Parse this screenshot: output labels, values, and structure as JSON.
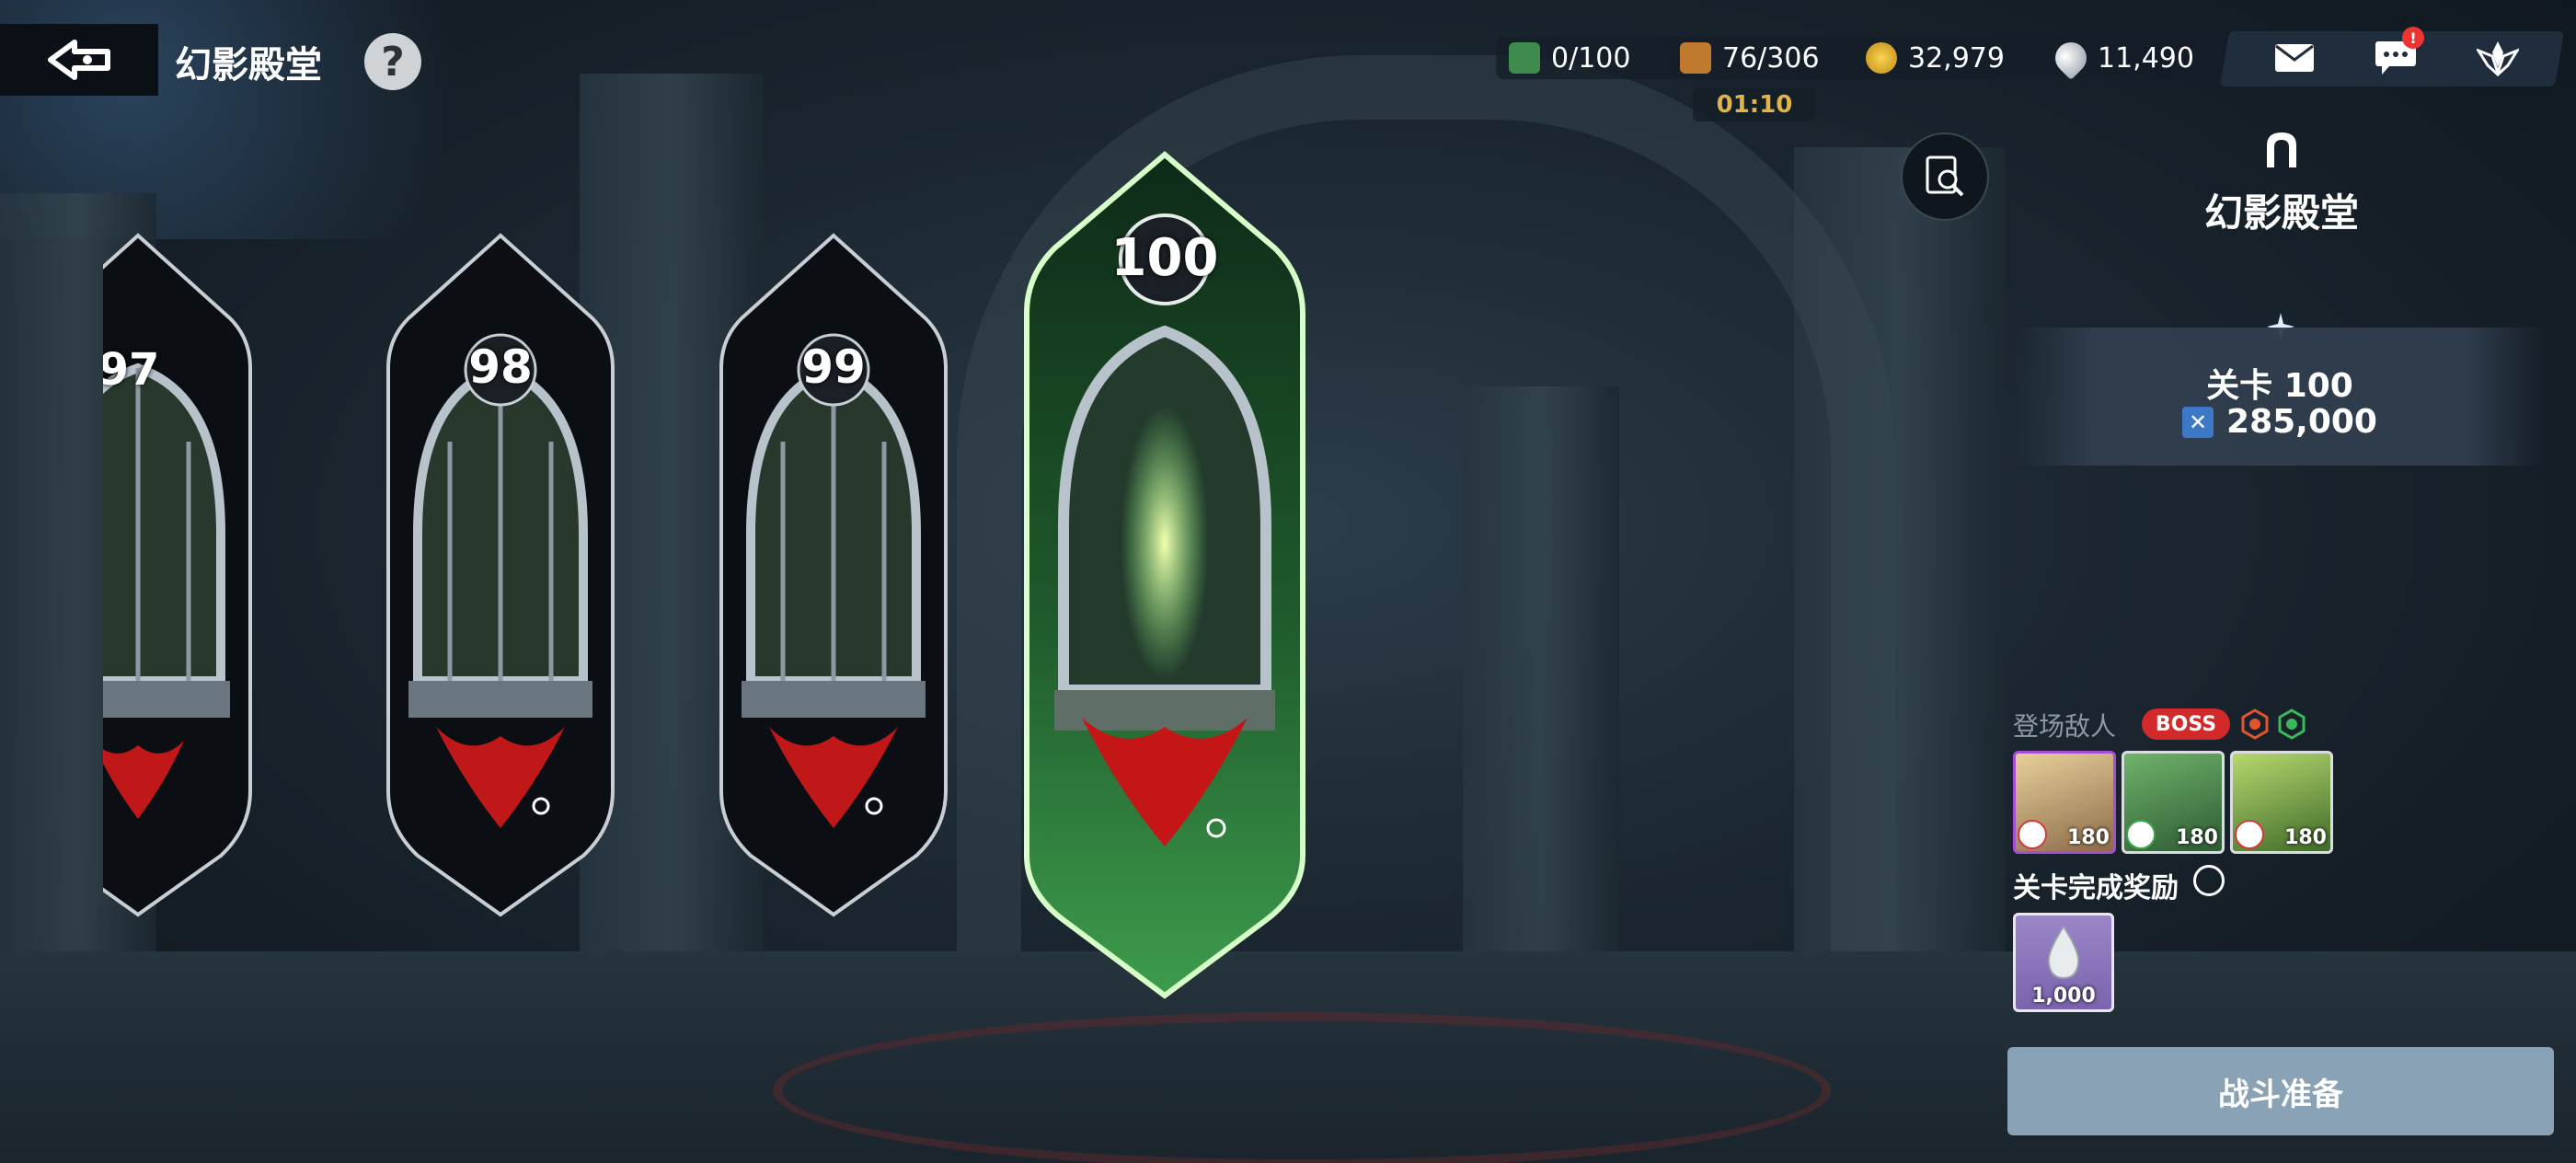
{
  "header": {
    "title": "幻影殿堂",
    "help": "?"
  },
  "resources": [
    {
      "name": "stamina-ticket",
      "value": "0/100",
      "color": "#3f8a4d"
    },
    {
      "name": "boots",
      "value": "76/306",
      "color": "#c07a2d"
    },
    {
      "name": "gold",
      "value": "32,979",
      "color": "#e3b12a"
    },
    {
      "name": "crystal",
      "value": "11,490",
      "color": "#cfd6dc"
    }
  ],
  "timer": "01:10",
  "notifications": {
    "chat_badge": "!"
  },
  "stages": [
    {
      "number": "97",
      "selected": false
    },
    {
      "number": "98",
      "selected": false
    },
    {
      "number": "99",
      "selected": false
    },
    {
      "number": "100",
      "selected": true
    }
  ],
  "panel": {
    "title": "幻影殿堂",
    "stage_label": "关卡 100",
    "power": "285,000",
    "enemies_label": "登场敌人",
    "boss_badge": "BOSS",
    "enemies": [
      {
        "level": "180",
        "class_color": "#d23a3a",
        "frame": "#a64fd6"
      },
      {
        "level": "180",
        "class_color": "#3aa84a",
        "frame": "#d9dde0"
      },
      {
        "level": "180",
        "class_color": "#d23a3a",
        "frame": "#d9dde0"
      }
    ],
    "reward_label": "关卡完成奖励",
    "reward_qty": "1,000",
    "battle_button": "战斗准备"
  },
  "colors": {
    "accent_green": "#7cf07a",
    "boss_red": "#d22a2a",
    "gold_text": "#e0b448"
  }
}
